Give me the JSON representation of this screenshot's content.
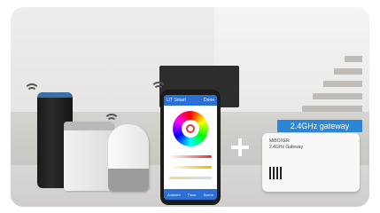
{
  "phone": {
    "app_title": "LIT Smart",
    "header_right": "Done",
    "footer_items": [
      "Ambient",
      "Timer",
      "Scene"
    ]
  },
  "gateway": {
    "label": "2.4GHz gateway",
    "brand": "MiBOXER",
    "model_text": "2.4GHz Gateway"
  },
  "colors": {
    "accent": "#2c86d6",
    "phone_blue": "#2c6fd6"
  },
  "icons": [
    "wifi-icon",
    "power-icon",
    "plus-icon"
  ]
}
